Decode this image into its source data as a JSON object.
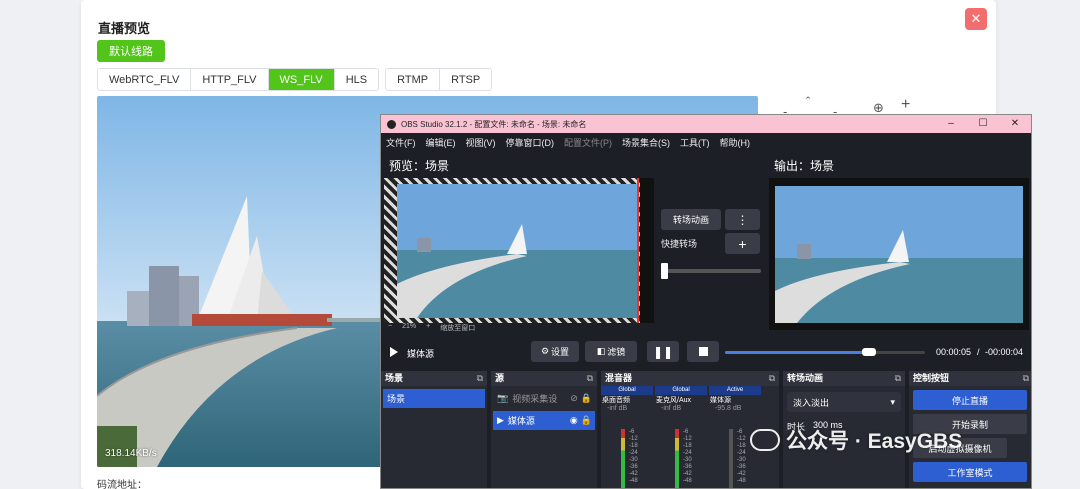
{
  "card": {
    "title": "直播预览",
    "route_button": "默认线路",
    "protocol_tabs": [
      "WebRTC_FLV",
      "HTTP_FLV",
      "WS_FLV",
      "HLS"
    ],
    "protocol_tabs2": [
      "RTMP",
      "RTSP"
    ],
    "active_tab": "WS_FLV",
    "bitrate": "318.14KB/s",
    "stream_label": "码流地址：",
    "close_glyph": "✕"
  },
  "ptz": {
    "up": "ˆ",
    "left": "-",
    "right": "-",
    "zoom_in": "⊕",
    "plus": "+"
  },
  "obs": {
    "title": "OBS Studio 32.1.2 - 配置文件: 未命名 - 场景: 未命名",
    "win_min": "–",
    "win_max": "☐",
    "win_close": "✕",
    "menu": [
      "文件(F)",
      "编辑(E)",
      "视图(V)",
      "停靠窗口(D)",
      "配置文件(P)",
      "场景集合(S)",
      "工具(T)",
      "帮助(H)"
    ],
    "preview_title": "预览：场景",
    "output_title": "输出：场景",
    "preview_foot": [
      "−",
      "21%",
      "+",
      "缩放至窗口"
    ],
    "transition_button": "转场动画",
    "more_glyph": "⋮",
    "quick_transition": "快捷转场",
    "add_glyph": "+",
    "media_source": "媒体源",
    "settings_button": "设置",
    "filters_button": "滤镜",
    "time_current": "00:00:05",
    "time_remaining": "-00:00:04",
    "progress": 0.72,
    "docks": {
      "scenes": {
        "title": "场景",
        "items": [
          "场景"
        ]
      },
      "sources": {
        "title": "源",
        "items": [
          "视频采集设",
          "媒体源"
        ]
      },
      "mixer": {
        "title": "混音器",
        "columns": [
          {
            "tag": "Global",
            "name": "桌面音频",
            "db": "-inf dB"
          },
          {
            "tag": "Global",
            "name": "麦克风/Aux",
            "db": "-inf dB"
          },
          {
            "tag": "Active",
            "name": "媒体源",
            "db": "-95.8 dB"
          }
        ],
        "scale": [
          "-6",
          "-12",
          "-18",
          "-24",
          "-30",
          "-36",
          "-42",
          "-48"
        ]
      },
      "transitions": {
        "title": "转场动画",
        "select": "淡入淡出",
        "duration_label": "时长",
        "duration_value": "300 ms"
      },
      "controls": {
        "title": "控制按钮",
        "buttons": [
          "停止直播",
          "开始录制",
          "启动虚拟摄像机",
          "工作室模式"
        ]
      }
    },
    "pop_glyph": "⧉"
  },
  "watermark": {
    "text": "公众号 · EasyGBS"
  },
  "colors": {
    "accent_green": "#52c41a",
    "obs_blue": "#2d5ed2",
    "close_red": "#f26d6d",
    "obs_title_pink": "#f9c3d4"
  }
}
